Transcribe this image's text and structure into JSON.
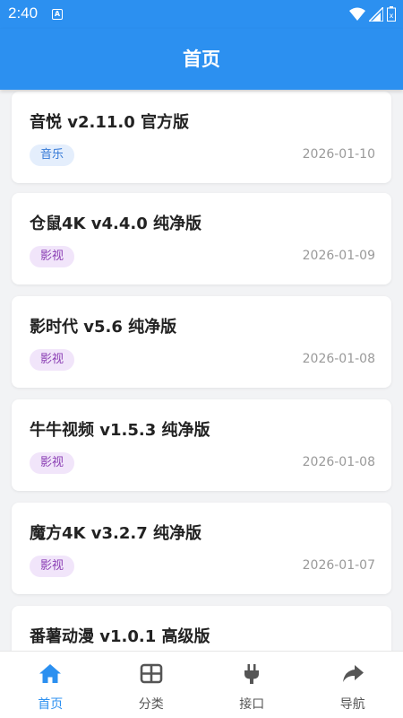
{
  "status": {
    "time": "2:40",
    "notification_glyph": "A"
  },
  "header": {
    "title": "首页"
  },
  "items": [
    {
      "title": "音悦 v2.11.0 官方版",
      "tag": "音乐",
      "tag_kind": "music",
      "date": "2026-01-10"
    },
    {
      "title": "仓鼠4K v4.4.0 纯净版",
      "tag": "影视",
      "tag_kind": "video",
      "date": "2026-01-09"
    },
    {
      "title": "影时代 v5.6 纯净版",
      "tag": "影视",
      "tag_kind": "video",
      "date": "2026-01-08"
    },
    {
      "title": "牛牛视频 v1.5.3 纯净版",
      "tag": "影视",
      "tag_kind": "video",
      "date": "2026-01-08"
    },
    {
      "title": "魔方4K v3.2.7 纯净版",
      "tag": "影视",
      "tag_kind": "video",
      "date": "2026-01-07"
    },
    {
      "title": "番薯动漫 v1.0.1 高级版"
    }
  ],
  "tabs": [
    {
      "label": "首页",
      "icon": "home-icon",
      "active": true
    },
    {
      "label": "分类",
      "icon": "grid-icon",
      "active": false
    },
    {
      "label": "接口",
      "icon": "plug-icon",
      "active": false
    },
    {
      "label": "导航",
      "icon": "share-icon",
      "active": false
    }
  ],
  "colors": {
    "accent": "#2c90f0",
    "music_tag_bg": "#e4eefc",
    "video_tag_bg": "#f1e5fa"
  }
}
